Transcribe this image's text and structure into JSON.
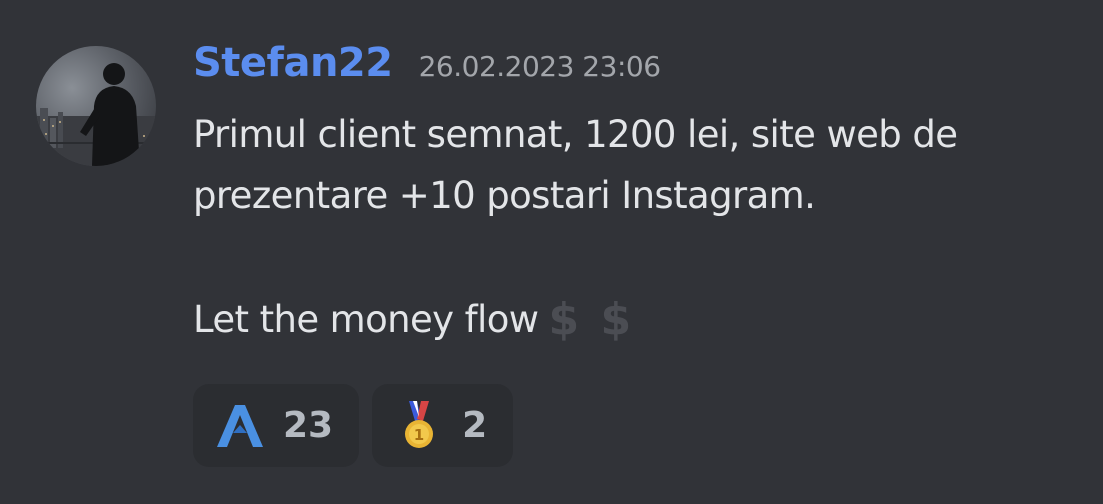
{
  "message": {
    "author": "Stefan22",
    "timestamp": "26.02.2023 23:06",
    "lines": [
      "Primul client semnat, 1200 lei, site web de",
      "prezentare +10 postari Instagram.",
      "",
      "Let the money flow"
    ],
    "trailing_emoji": [
      "$",
      "$"
    ],
    "colors": {
      "author": "#5b8def",
      "text": "#e3e5e8",
      "timestamp": "#a3a6ab",
      "background": "#313338",
      "reaction_bg": "#2b2d31"
    }
  },
  "reactions": [
    {
      "icon": "a-logo-icon",
      "count": "23",
      "color": "#4a90e2"
    },
    {
      "icon": "medal-icon",
      "count": "2",
      "color": "#e8b434"
    }
  ]
}
